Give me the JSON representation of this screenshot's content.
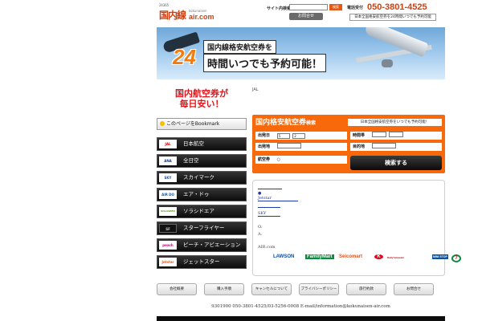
{
  "header": {
    "logo_small": "24365",
    "logo_main": "国内線",
    "logo_sub": "kokunaisen",
    "logo_domain": "air.com",
    "search_label": "サイト内検索",
    "search_value": "",
    "search_button": "検索",
    "inquiry_button": "お問合せ",
    "phone_label": "電話受付",
    "phone_number": "050-3801-4525",
    "phone_note": "日本全国格安航空券を24時間いつでも予約可能"
  },
  "hero": {
    "line1": "国内線格安航空券を",
    "big_number": "24",
    "line2": "時間いつでも予約可能！"
  },
  "promo": {
    "line1": "国内航空券が",
    "line2": "毎日安い！"
  },
  "bookmark": {
    "label": "このページをBookmark"
  },
  "airlines": [
    {
      "logo": "JAL",
      "name": "日本航空"
    },
    {
      "logo": "ANA",
      "name": "全日空"
    },
    {
      "logo": "SKY",
      "name": "スカイマーク"
    },
    {
      "logo": "AIR DO",
      "name": "エア・ドゥ"
    },
    {
      "logo": "SOLASEED",
      "name": "ソラシドエア"
    },
    {
      "logo": "SF",
      "name": "スターフライヤー"
    },
    {
      "logo": "peach",
      "name": "ピーチ・アビエーション"
    },
    {
      "logo": "Jetstar",
      "name": "ジェットスター"
    }
  ],
  "jal_mini": "JAL",
  "search_panel": {
    "title": "国内格安航空券",
    "title_suffix": "検索",
    "note": "日本全国格安航空券をいつでも予約可能！",
    "departure_date_label": "出発日",
    "departure_month": "5",
    "departure_day": "2",
    "time_label": "時間帯",
    "origin_label": "出発地",
    "destination_label": "目的地",
    "airline_label": "航空券",
    "airline_option": "○",
    "search_button": "検索する"
  },
  "info": {
    "line_bullet": "●",
    "line_jetstar": "Jetstar",
    "line_sky": "SKY",
    "line_o": "O.",
    "line_a": "A.",
    "line_aircom": "AIR.com"
  },
  "convenience": [
    "LAWSON",
    "FamilyMart",
    "Seicomart",
    "K",
    "DailyYamazaki",
    "MINI STOP",
    "7"
  ],
  "footer_nav": [
    "会社概要",
    "購入手順",
    "キャンセルについて",
    "プライバシーポリシー",
    "旅行約款",
    "お問合せ"
  ],
  "footer_text": "9301900 050-3801-4525/03-5256-0008 E-mail/information@kokunaisen-air.com",
  "colors": {
    "accent": "#f7690a",
    "brand_red": "#d04010",
    "promo_red": "#e0151c"
  }
}
